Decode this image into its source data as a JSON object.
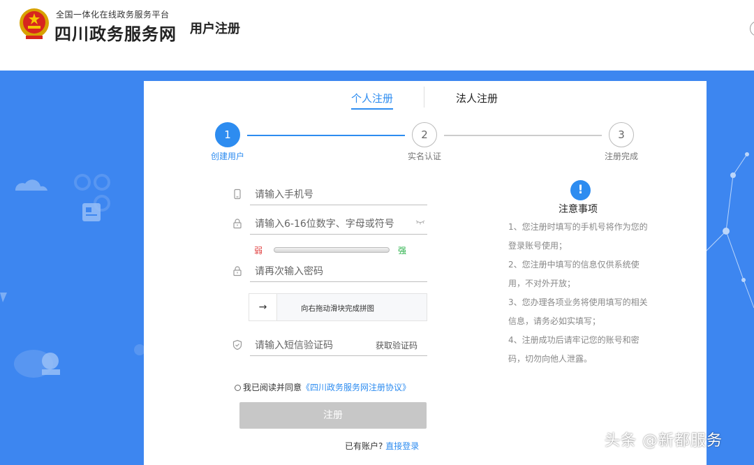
{
  "header": {
    "platform_subtitle": "全国一体化在线政务服务平台",
    "site_name": "四川政务服务网",
    "page_title": "用户注册"
  },
  "tabs": [
    {
      "label": "个人注册",
      "active": true
    },
    {
      "label": "法人注册",
      "active": false
    }
  ],
  "steps": [
    {
      "number": "1",
      "label": "创建用户",
      "active": true
    },
    {
      "number": "2",
      "label": "实名认证",
      "active": false
    },
    {
      "number": "3",
      "label": "注册完成",
      "active": false
    }
  ],
  "form": {
    "phone_placeholder": "请输入手机号",
    "password_placeholder": "请输入6-16位数字、字母或符号",
    "strength_weak": "弱",
    "strength_strong": "强",
    "confirm_placeholder": "请再次输入密码",
    "slider_arrow": "→",
    "slider_text": "向右拖动滑块完成拼图",
    "sms_placeholder": "请输入短信验证码",
    "get_code_label": "获取验证码",
    "agree_prefix": "我已阅读并同意",
    "agreement_link": "《四川政务服务网注册协议》",
    "submit_label": "注册",
    "has_account_text": "已有账户?",
    "login_link": "直接登录"
  },
  "notice": {
    "icon": "!",
    "title": "注意事项",
    "lines": [
      "1、您注册时填写的手机号将作为您的",
      "登录账号使用；",
      "2、您注册中填写的信息仅供系统使",
      "用，不对外开放；",
      "3、您办理各项业务将使用填写的相关",
      "信息，请务必如实填写；",
      "4、注册成功后请牢记您的账号和密",
      "码，切勿向他人泄露。"
    ]
  },
  "watermark": "头条 @新都服务",
  "colors": {
    "primary": "#2d8cf0",
    "background_blue": "#3d86f0",
    "button_disabled": "#c7c7c7",
    "weak": "#e03c3c",
    "strong": "#2ab24a"
  },
  "icons": {
    "emblem": "national-emblem-icon",
    "phone": "phone-icon",
    "lock": "lock-icon",
    "eye": "eye-closed-icon",
    "shield": "shield-icon"
  }
}
